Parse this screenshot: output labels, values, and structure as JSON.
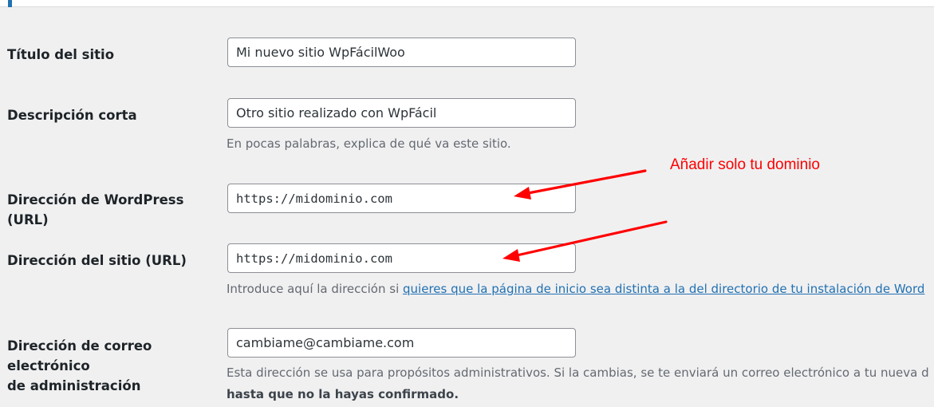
{
  "form": {
    "site_title": {
      "label": "Título del sitio",
      "value": "Mi nuevo sitio WpFácilWoo"
    },
    "tagline": {
      "label": "Descripción corta",
      "value": "Otro sitio realizado con WpFácil",
      "help": "En pocas palabras, explica de qué va este sitio."
    },
    "wordpress_url": {
      "label": "Dirección de WordPress (URL)",
      "value": "https://midominio.com"
    },
    "site_url": {
      "label": "Dirección del sitio (URL)",
      "value": "https://midominio.com",
      "help_prefix": "Introduce aquí la dirección si ",
      "help_link": "quieres que la página de inicio sea distinta a la del directorio de tu instalación de Word"
    },
    "admin_email": {
      "label_line1": "Dirección de correo electrónico",
      "label_line2": "de administración",
      "value": "cambiame@cambiame.com",
      "help": "Esta dirección se usa para propósitos administrativos. Si la cambias, se te enviará un correo electrónico a tu nueva d",
      "help_strong": "hasta que no la hayas confirmado."
    }
  },
  "annotation": {
    "text": "Añadir solo tu dominio",
    "color": "#ff0000"
  },
  "colors": {
    "accent": "#2271b1",
    "background": "#f0f0f1",
    "annotation": "#ff0000"
  }
}
